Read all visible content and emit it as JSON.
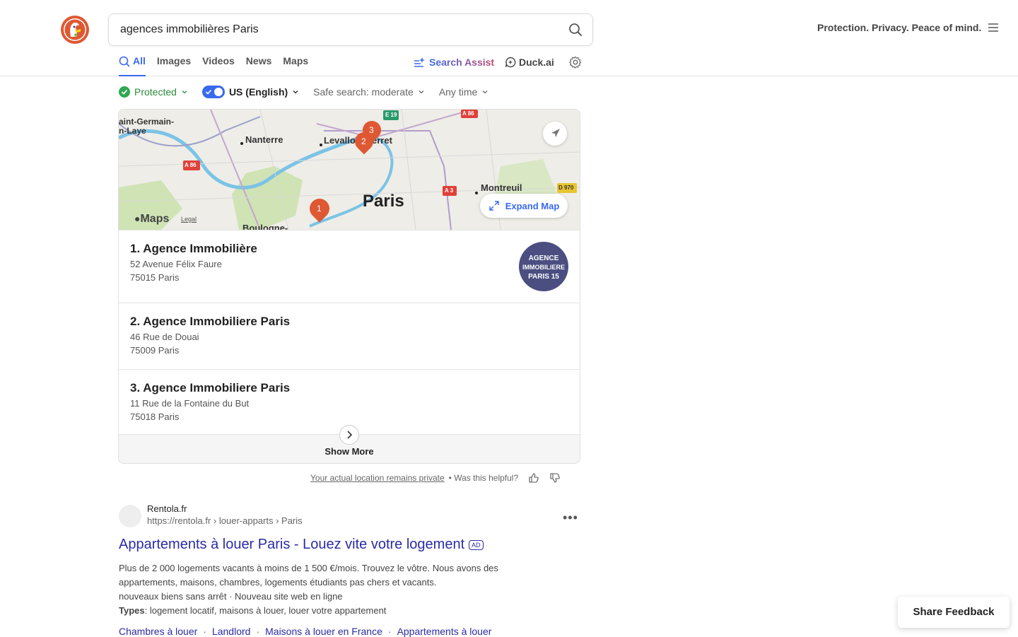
{
  "search": {
    "query": "agences immobilières Paris"
  },
  "header": {
    "tagline": "Protection. Privacy. Peace of mind."
  },
  "tabs": [
    {
      "label": "All"
    },
    {
      "label": "Images"
    },
    {
      "label": "Videos"
    },
    {
      "label": "News"
    },
    {
      "label": "Maps"
    }
  ],
  "assist": {
    "search_assist": "Search Assist",
    "duck_ai": "Duck.ai"
  },
  "filters": {
    "protected": "Protected",
    "region": "US (English)",
    "safe_search": "Safe search: moderate",
    "time": "Any time"
  },
  "map": {
    "labels": [
      "aint-Germain-",
      "n-Laye",
      "Nanterre",
      "Levallo",
      "erret",
      "Paris",
      "Montreuil",
      "Boulogne-"
    ],
    "road_badges": [
      "A 86",
      "E 19",
      "A 86",
      "A 3",
      "D 970"
    ],
    "markers": [
      "1",
      "2",
      "3"
    ],
    "brand": "Maps",
    "legal": "Legal",
    "expand": "Expand Map"
  },
  "places": [
    {
      "title": "1. Agence Immobilière",
      "line1": "52 Avenue Félix Faure",
      "line2": "75015 Paris",
      "logo_text": [
        "AGENCE",
        "IMMOBILIERE",
        "PARIS 15"
      ]
    },
    {
      "title": "2. Agence Immobiliere Paris",
      "line1": "46 Rue de Douai",
      "line2": "75009 Paris"
    },
    {
      "title": "3. Agence Immobiliere Paris",
      "line1": "11 Rue de la Fontaine du But",
      "line2": "75018 Paris"
    }
  ],
  "show_more": "Show More",
  "location_feedback": {
    "private": "Your actual location remains private",
    "helpful": "• Was this helpful?"
  },
  "result": {
    "site": "Rentola.fr",
    "url": "https://rentola.fr › louer-apparts › Paris",
    "title": "Appartements à louer Paris - Louez vite votre logement",
    "ad": "AD",
    "snippet1": "Plus de 2 000 logements vacants à moins de 1 500 €/mois. Trouvez le vôtre. Nous avons des appartements, maisons, chambres, logements étudiants pas chers et vacants.",
    "snippet2": "nouveaux biens sans arrêt · Nouveau site web en ligne",
    "types_label": "Types",
    "types_value": ": logement locatif, maisons à louer, louer votre appartement",
    "sitelinks": [
      "Chambres à louer",
      "Landlord",
      "Maisons à louer en France",
      "Appartements à louer"
    ]
  },
  "share_feedback": "Share Feedback"
}
